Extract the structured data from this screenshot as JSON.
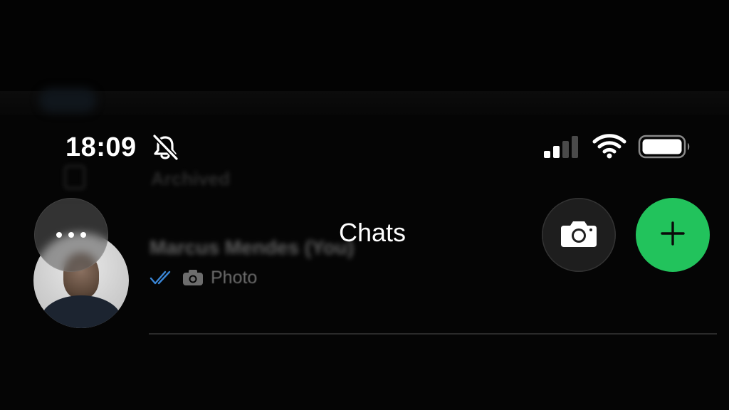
{
  "status_bar": {
    "time": "18:09",
    "icons": [
      "bell-slash-icon",
      "cellular-signal-icon",
      "wifi-icon",
      "battery-icon"
    ]
  },
  "header": {
    "title": "Chats",
    "more_icon": "ellipsis-icon",
    "camera_icon": "camera-icon",
    "new_chat_icon": "plus-icon"
  },
  "archived": {
    "label": "Archived",
    "icon": "archive-icon"
  },
  "chats": [
    {
      "name": "Marcus Mendes (You)",
      "preview": "Photo",
      "preview_icon": "camera-icon",
      "status_icon": "double-check-icon"
    }
  ],
  "colors": {
    "background": "#050505",
    "accent_green": "#22c35c",
    "read_ticks": "#3a86d6"
  }
}
